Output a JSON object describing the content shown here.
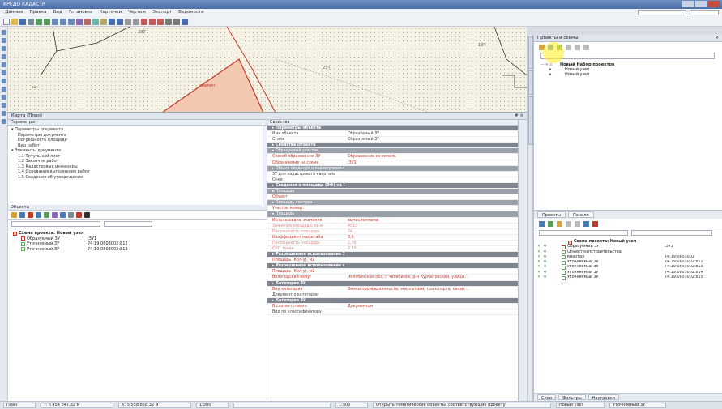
{
  "window": {
    "title": "КРЕДО КАДАСТР"
  },
  "menu": [
    "Данные",
    "Правка",
    "Вид",
    "Установка",
    "Карточки",
    "Чертеж",
    "Экспорт",
    "Ведомости"
  ],
  "map": {
    "labels": [
      "2ЭТ",
      "кирпич",
      "2ЭТ",
      "ш",
      "1ЭТ"
    ]
  },
  "panel": {
    "title": "Карта (План)",
    "close": "# ×"
  },
  "documents": {
    "header": "Параметры",
    "items": [
      "▾ Параметры документа",
      "Параметры документа",
      "Погрешность площади",
      "Вид работ",
      "▾ Элементы документа",
      "1.1 Титульный лист",
      "1.2 Заказчик работ",
      "1.3 Кадастровые инженеры",
      "1.4 Основания выполнения работ",
      "1.5 Сведения об утверждении"
    ]
  },
  "objects": {
    "header": "Объекты",
    "tree_root": "Схема проекта: Новый узел",
    "rows": [
      {
        "name": "Образуемый ЗУ",
        "value": ":ЗУ1"
      },
      {
        "name": "Уточняемый ЗУ",
        "value": "74:19:0803002:812"
      },
      {
        "name": "Уточняемый ЗУ",
        "value": "74:19:0803002:813"
      }
    ]
  },
  "properties": {
    "header": "Свойства",
    "rows": [
      {
        "style": "g1",
        "k": "▸ Параметры объекта",
        "v": ""
      },
      {
        "style": "plain",
        "k": "Имя объекта",
        "v": "Образуемый ЗУ"
      },
      {
        "style": "plain",
        "k": "Стиль",
        "v": "Образуемый ЗУ"
      },
      {
        "style": "g1",
        "k": "▸ Свойства объекта",
        "v": ""
      },
      {
        "style": "g2",
        "k": "▸ Образуемый участок",
        "v": ""
      },
      {
        "style": "red",
        "k": "Способ образования ЗУ",
        "v": "Образование из земель"
      },
      {
        "style": "red",
        "k": "Обозначение на схеме",
        "v": ":ЗУ1"
      },
      {
        "style": "g2",
        "k": "▸ Общие сведения о кадастровом квартале",
        "v": ""
      },
      {
        "style": "plain",
        "k": "ЗУ для кадастрового квартала",
        "v": ""
      },
      {
        "style": "plain",
        "k": "Очки",
        "v": ""
      },
      {
        "style": "g1",
        "k": "▸ Сведения о площади (ЭФ) на ЗУ",
        "v": ""
      },
      {
        "style": "g2",
        "k": "▸ Площадь",
        "v": ""
      },
      {
        "style": "red",
        "k": "Объект",
        "v": ""
      },
      {
        "style": "g2",
        "k": "▸ Площадь контура",
        "v": ""
      },
      {
        "style": "red",
        "k": "Участок номер",
        "v": ""
      },
      {
        "style": "g2",
        "k": "▸ Площадь",
        "v": ""
      },
      {
        "style": "red",
        "k": "Использованы значения",
        "v": "вычисленными"
      },
      {
        "style": "faint",
        "k": "Значение площади, кв.м",
        "v": "4513"
      },
      {
        "style": "faint",
        "k": "Погрешность площади",
        "v": "24"
      },
      {
        "style": "red",
        "k": "Коэффициент масштаба",
        "v": "3,6"
      },
      {
        "style": "faint",
        "k": "Погрешность площади",
        "v": "2,78"
      },
      {
        "style": "faint",
        "k": "СКП точки",
        "v": "0,10"
      },
      {
        "style": "g1",
        "k": "▸ Разрешенное использование ЗУ",
        "v": ""
      },
      {
        "style": "red",
        "k": "Площадь (Кол-у), м2",
        "v": ""
      },
      {
        "style": "g1",
        "k": "▸ Разрешенное использование по закону ЗУ",
        "v": ""
      },
      {
        "style": "red",
        "k": "Площадь (Кол-у), м2",
        "v": ""
      },
      {
        "style": "red",
        "k": "Вологодский округ",
        "v": "Челябинская обл, г Челябинск, р-н Курчатовский, улица..."
      },
      {
        "style": "g1",
        "k": "▸ Категория ЗУ",
        "v": ""
      },
      {
        "style": "red",
        "k": "Вид категории",
        "v": "Земли промышленности, энергетики, транспорта, связи..."
      },
      {
        "style": "plain",
        "k": "Документ о категории",
        "v": ""
      },
      {
        "style": "g1",
        "k": "▸ Категория ЗУ",
        "v": ""
      },
      {
        "style": "red",
        "k": "В соответствии с",
        "v": "Документом"
      },
      {
        "style": "plain",
        "k": "Вид по классификатору",
        "v": ""
      }
    ]
  },
  "right_panel": {
    "title": "Проекты и схемы",
    "close": "×",
    "tree": [
      {
        "indent": 0,
        "label": "Новый Набор проектов"
      },
      {
        "indent": 1,
        "label": "Новый узел"
      },
      {
        "indent": 1,
        "label": "Новый узел"
      }
    ],
    "tabs": [
      "Проекты",
      "Панели"
    ],
    "lower_root": "Схема проекта: Новый узел",
    "layers": [
      {
        "ctl": "✕ ✥",
        "name": "Образуемый ЗУ",
        "value": ":ЗУ1"
      },
      {
        "ctl": "✕ ✥",
        "name": "Объект капстроительства",
        "value": ""
      },
      {
        "ctl": "✕ ✥",
        "name": "Квартал",
        "value": "74:19:0803002"
      },
      {
        "ctl": "✕ ✥",
        "name": "Уточняемый ЗУ",
        "value": "74:19:0803002:812"
      },
      {
        "ctl": "✕ ✥",
        "name": "Уточняемый ЗУ",
        "value": "74:19:0803002:813"
      },
      {
        "ctl": "✕ ✥",
        "name": "Уточняемый ЗУ",
        "value": "74:19:0803002:814"
      },
      {
        "ctl": "✕ ✥",
        "name": "Уточняемый ЗУ",
        "value": "74:19:0803002:815"
      }
    ],
    "bottom_tabs": [
      "Слои",
      "Фильтры",
      "Настройки"
    ]
  },
  "status": {
    "items": [
      "План",
      "Y: 6 454 547,32 м",
      "X: 5 558 858,32 м",
      "1:500",
      "",
      "1:500",
      "Открыть тематические объекты, соответствующие проекту",
      "Новый узел",
      "Уточняемый ЗУ"
    ]
  }
}
